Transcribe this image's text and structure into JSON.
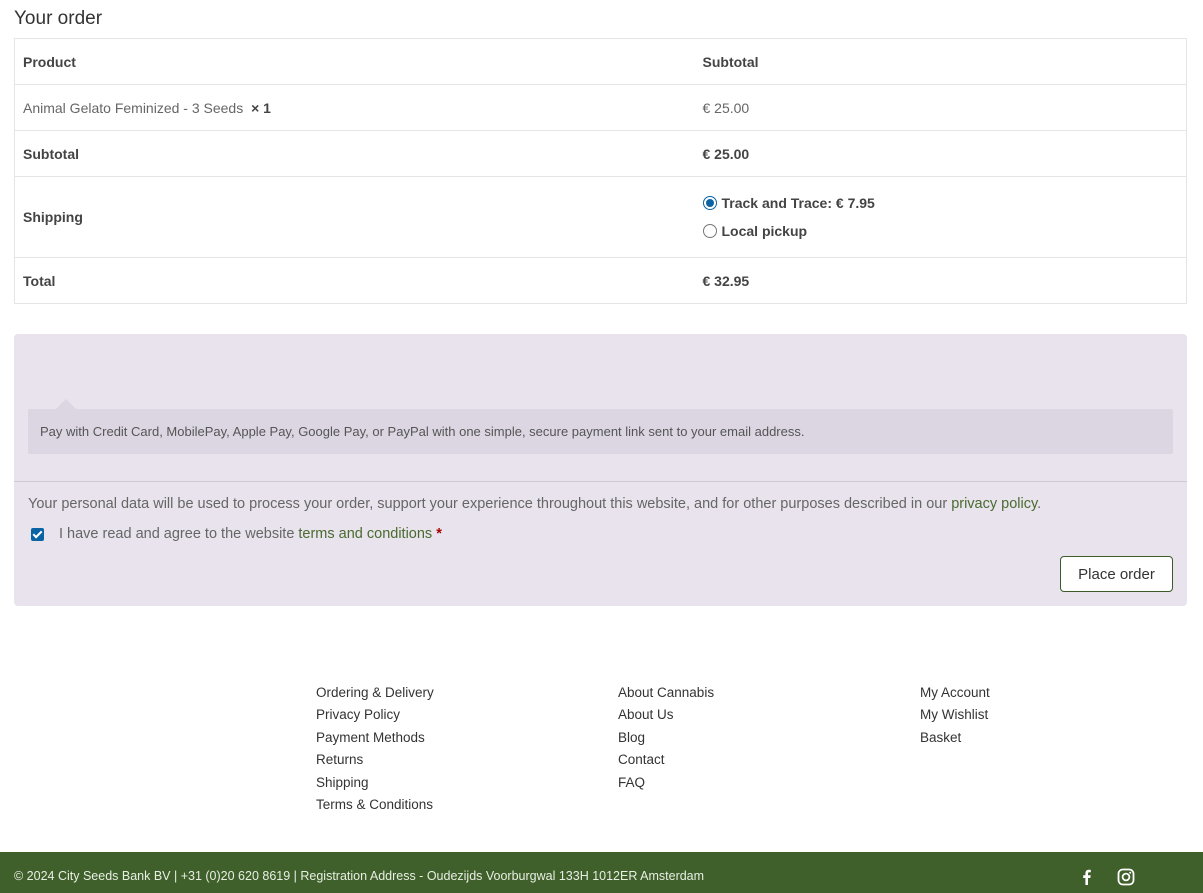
{
  "order": {
    "heading": "Your order",
    "col_product": "Product",
    "col_subtotal": "Subtotal",
    "items": [
      {
        "name": "Animal Gelato Feminized - 3 Seeds",
        "qty": "× 1",
        "price": "€ 25.00"
      }
    ],
    "subtotal_label": "Subtotal",
    "subtotal_value": "€ 25.00",
    "shipping_label": "Shipping",
    "shipping_options": [
      {
        "label": "Track and Trace: € 7.95",
        "selected": true
      },
      {
        "label": "Local pickup",
        "selected": false
      }
    ],
    "total_label": "Total",
    "total_value": "€ 32.95"
  },
  "payment": {
    "description": "Pay with Credit Card, MobilePay, Apple Pay, Google Pay, or PayPal with one simple, secure payment link sent to your email address.",
    "privacy_text": "Your personal data will be used to process your order, support your experience throughout this website, and for other purposes described in our ",
    "privacy_link": "privacy policy",
    "privacy_end": ".",
    "terms_text": "I have read and agree to the website ",
    "terms_link": "terms and conditions",
    "terms_required": "*",
    "place_order": "Place order"
  },
  "footer": {
    "col1": [
      "Ordering & Delivery",
      "Privacy Policy",
      "Payment Methods",
      "Returns",
      "Shipping",
      "Terms & Conditions"
    ],
    "col2": [
      "About Cannabis",
      "About Us",
      "Blog",
      "Contact",
      "FAQ"
    ],
    "col3": [
      "My Account",
      "My Wishlist",
      "Basket"
    ],
    "copyright": "© 2024 City Seeds Bank BV | +31 (0)20 620 8619 | Registration Address - Oudezijds Voorburgwal 133H 1012ER Amsterdam",
    "social": [
      "facebook-icon",
      "instagram-icon"
    ]
  },
  "colors": {
    "accent": "#0a64a4",
    "brand_green": "#3f5f2b",
    "payment_bg": "#e8e3ec"
  }
}
